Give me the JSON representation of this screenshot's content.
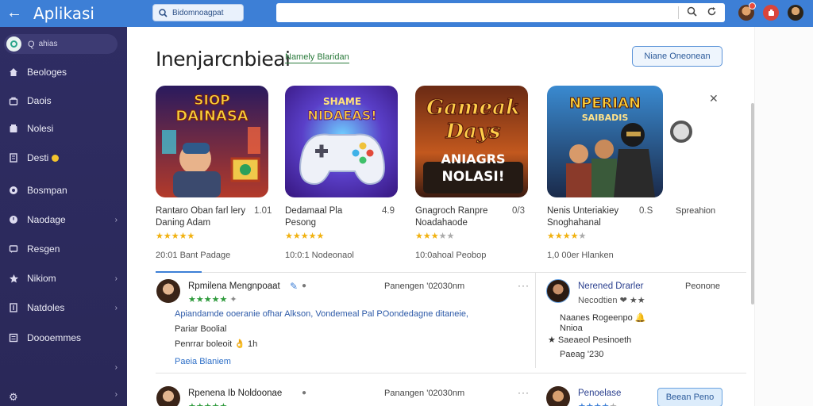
{
  "topbar": {
    "back_label": "←",
    "title": "Aplikasi",
    "search_text": "Bidomnoagpat",
    "badge_count": "3"
  },
  "sidebar": {
    "search_text": "ahias",
    "items": [
      {
        "label": "Beologes",
        "icon": "home-icon"
      },
      {
        "label": "Daois",
        "icon": "bag-icon"
      },
      {
        "label": "Nolesi",
        "icon": "box-icon"
      },
      {
        "label": "Desti",
        "icon": "file-icon"
      },
      {
        "label": "Bosmpan",
        "icon": "circle-icon"
      },
      {
        "label": "Naodage",
        "icon": "clock-icon"
      },
      {
        "label": "Resgen",
        "icon": "chat-icon"
      },
      {
        "label": "Nikiom",
        "icon": "star-icon"
      },
      {
        "label": "Natdoles",
        "icon": "doc-icon"
      },
      {
        "label": "Doooemmes",
        "icon": "list-icon"
      }
    ]
  },
  "main": {
    "title": "Inenjarcnbieai",
    "sub_link": "Namely Blaridan",
    "header_button": "Niane Oneonean",
    "cards": [
      {
        "title": "Rantaro Oban farl lery",
        "version": "1.01",
        "subtitle": "Daning Adam",
        "rating": 5,
        "meta": "20:01 Bant Padage",
        "art_text_1": "SIOP",
        "art_text_2": "DAINASA"
      },
      {
        "title": "Dedamaal Pla",
        "version": "4.9",
        "subtitle": "Pesong",
        "rating": 5,
        "meta": "10:0:1 Nodeonaol",
        "art_text_1": "SHAME",
        "art_text_2": "NIDAEAS!"
      },
      {
        "title": "Gnagroch Ranpre",
        "version": "0/3",
        "subtitle": "Noadahaode",
        "rating": 3,
        "meta": "10:0ahoal Peobop",
        "art_text_1": "Gameak",
        "art_text_2": "Days",
        "art_text_3": "ANIAGRS",
        "art_text_4": "NOLASI!"
      },
      {
        "title": "Nenis Unteriakiey",
        "version": "0.S",
        "subtitle": "Snoghahanal",
        "rating": 4,
        "meta": "1,0 00er Hlanken",
        "art_text_1": "NPERIAN",
        "art_text_2": "SAIBADIS",
        "tag": "Spreahion"
      }
    ],
    "reviews": [
      {
        "name": "Rpmilena Mengnpoaat",
        "date": "Panengen '02030nm",
        "rating": 5,
        "text_1": "Apiandamde ooeranie ofhar Alkson, Vondemeal Pal POondedagne ditaneie,",
        "text_2": "Pariar Boolial",
        "text_3": "Penrrar boleoit 👌 1h",
        "link": "Paeia Blaniem"
      },
      {
        "name": "Nerened Drarler",
        "date": "Peonone",
        "rating": 3,
        "text_1": "Necodtien ❤ ★★",
        "text_2": "Naanes Rogeenpo 🔔",
        "text_3": "Nnioa",
        "text_4": "★ Saeaeol Pesinoeth",
        "text_5": "Paeag '230"
      },
      {
        "name": "Rpenena Ib Noldoonae",
        "date": "Panangen '02030nm",
        "rating": 5
      },
      {
        "name": "Penoelase",
        "follow_button": "Beean Peno",
        "rating": 4
      }
    ]
  },
  "colors": {
    "topbar": "#3d7fd6",
    "sidebar": "#2f2d63",
    "accent": "#3d7fd6",
    "star": "#f1b10f",
    "star_green": "#2e9a3c"
  }
}
